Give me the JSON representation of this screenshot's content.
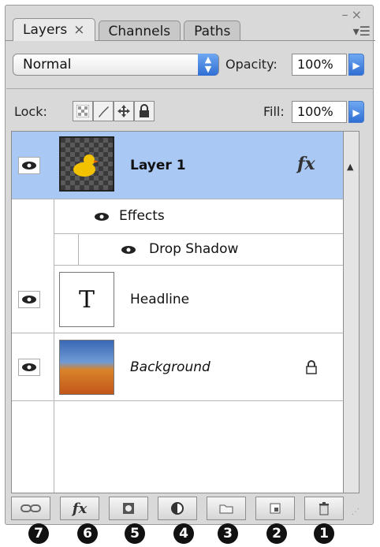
{
  "window": {
    "minimize_label": "–",
    "close_label": "×"
  },
  "tabs": [
    {
      "label": "Layers",
      "active": true,
      "close": "×"
    },
    {
      "label": "Channels",
      "active": false
    },
    {
      "label": "Paths",
      "active": false
    }
  ],
  "panel_menu_icon": "panel-menu-icon",
  "blend": {
    "mode": "Normal",
    "opacity_label": "Opacity:",
    "opacity_value": "100%"
  },
  "lock": {
    "label": "Lock:",
    "fill_label": "Fill:",
    "fill_value": "100%"
  },
  "layers": [
    {
      "name": "Layer 1",
      "selected": true,
      "fx": "fx",
      "effects_label": "Effects",
      "effects": [
        "Drop Shadow"
      ]
    },
    {
      "name": "Headline",
      "thumb_text": "T"
    },
    {
      "name": "Background",
      "italic": true,
      "locked": true
    }
  ],
  "bottom_buttons": [
    {
      "name": "link-layers-button",
      "label": "⚭",
      "callout": "7"
    },
    {
      "name": "layer-style-button",
      "label": "fx",
      "callout": "6"
    },
    {
      "name": "layer-mask-button",
      "label": "◘",
      "callout": "5"
    },
    {
      "name": "adjustment-layer-button",
      "label": "◐",
      "callout": "4"
    },
    {
      "name": "new-group-button",
      "label": "▭",
      "callout": "3"
    },
    {
      "name": "new-layer-button",
      "label": "❏",
      "callout": "2"
    },
    {
      "name": "delete-layer-button",
      "label": "🗑",
      "callout": "1"
    }
  ],
  "colors": {
    "selection": "#a9c8f4",
    "accent_blue": "#2f6ed3",
    "panel_bg": "#d9d9d9"
  }
}
